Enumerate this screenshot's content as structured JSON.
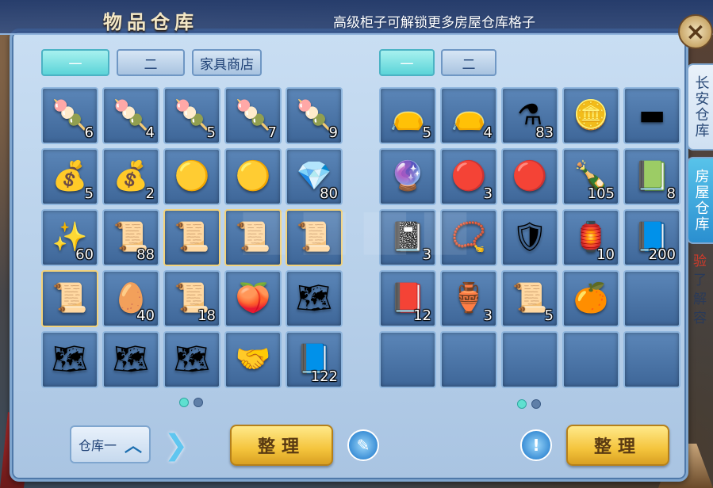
{
  "header": {
    "title": "物品仓库",
    "subtitle": "高级柜子可解锁更多房屋仓库格子",
    "close_icon": "×"
  },
  "side_tabs": [
    {
      "label": "长安仓库",
      "active": false
    },
    {
      "label": "房屋仓库",
      "active": true
    }
  ],
  "side_note": {
    "accent": "验",
    "text": "了解",
    "tail": "容"
  },
  "left_panel": {
    "tabs": [
      {
        "label": "一",
        "active": true
      },
      {
        "label": "二",
        "active": false
      },
      {
        "label": "家具商店",
        "active": false
      }
    ],
    "slots": [
      {
        "icon": "tangyuan-plate-brown",
        "glyph": "🍡",
        "count": "6"
      },
      {
        "icon": "tangyuan-plate-flower",
        "glyph": "🍡",
        "count": "4"
      },
      {
        "icon": "tangyuan-plate-red",
        "glyph": "🍡",
        "count": "5"
      },
      {
        "icon": "tangyuan-plate-pink",
        "glyph": "🍡",
        "count": "7"
      },
      {
        "icon": "tangyuan-plate-dark",
        "glyph": "🍡",
        "count": "9"
      },
      {
        "icon": "money-bag",
        "glyph": "💰",
        "count": "5"
      },
      {
        "icon": "money-bag",
        "glyph": "💰",
        "count": "2"
      },
      {
        "icon": "golden-orb",
        "glyph": "🟡",
        "count": ""
      },
      {
        "icon": "golden-orb",
        "glyph": "🟡",
        "count": ""
      },
      {
        "icon": "blue-crystal",
        "glyph": "💎",
        "count": "80"
      },
      {
        "icon": "sparkle-crystal",
        "glyph": "✨",
        "count": "60"
      },
      {
        "icon": "talisman-scroll",
        "glyph": "📜",
        "count": "88"
      },
      {
        "icon": "golden-scroll",
        "glyph": "📜",
        "count": "",
        "gold": true
      },
      {
        "icon": "golden-scroll",
        "glyph": "📜",
        "count": "",
        "gold": true
      },
      {
        "icon": "golden-scroll",
        "glyph": "📜",
        "count": "",
        "gold": true
      },
      {
        "icon": "golden-scroll",
        "glyph": "📜",
        "count": "",
        "gold": true
      },
      {
        "icon": "jade-egg",
        "glyph": "🥚",
        "count": "40"
      },
      {
        "icon": "fire-scroll",
        "glyph": "📜",
        "count": "18"
      },
      {
        "icon": "peach",
        "glyph": "🍑",
        "count": ""
      },
      {
        "icon": "treasure-map",
        "glyph": "🗺",
        "count": ""
      },
      {
        "icon": "treasure-map",
        "glyph": "🗺",
        "count": ""
      },
      {
        "icon": "treasure-map",
        "glyph": "🗺",
        "count": ""
      },
      {
        "icon": "treasure-map",
        "glyph": "🗺",
        "count": ""
      },
      {
        "icon": "handshake-badge",
        "glyph": "🤝",
        "count": ""
      },
      {
        "icon": "blue-book",
        "glyph": "📘",
        "count": "122"
      }
    ],
    "page_dots": [
      true,
      false
    ]
  },
  "right_panel": {
    "tabs": [
      {
        "label": "一",
        "active": true
      },
      {
        "label": "二",
        "active": false
      }
    ],
    "slots": [
      {
        "icon": "black-pouch",
        "glyph": "👝",
        "count": "5"
      },
      {
        "icon": "black-pouch",
        "glyph": "👝",
        "count": "4"
      },
      {
        "icon": "potion-flask",
        "glyph": "⚗",
        "count": "83"
      },
      {
        "icon": "silver-ingot",
        "glyph": "🪙",
        "count": ""
      },
      {
        "icon": "silver-bar",
        "glyph": "▬",
        "count": ""
      },
      {
        "icon": "crystal-ball",
        "glyph": "🔮",
        "count": ""
      },
      {
        "icon": "red-stone",
        "glyph": "🔴",
        "count": "3"
      },
      {
        "icon": "red-stone",
        "glyph": "🔴",
        "count": ""
      },
      {
        "icon": "green-bottle",
        "glyph": "🍾",
        "count": "105"
      },
      {
        "icon": "teal-book",
        "glyph": "📗",
        "count": "8"
      },
      {
        "icon": "black-book",
        "glyph": "📓",
        "count": "3"
      },
      {
        "icon": "necklace",
        "glyph": "📿",
        "count": ""
      },
      {
        "icon": "armor-wings",
        "glyph": "🛡",
        "count": ""
      },
      {
        "icon": "lantern",
        "glyph": "🏮",
        "count": "10"
      },
      {
        "icon": "blue-book",
        "glyph": "📘",
        "count": "200"
      },
      {
        "icon": "red-book",
        "glyph": "📕",
        "count": "12"
      },
      {
        "icon": "gourd-bag",
        "glyph": "🏺",
        "count": "3"
      },
      {
        "icon": "paper-scroll",
        "glyph": "📜",
        "count": "5"
      },
      {
        "icon": "oranges",
        "glyph": "🍊",
        "count": ""
      },
      {
        "icon": "empty",
        "glyph": "",
        "count": ""
      },
      {
        "icon": "empty",
        "glyph": "",
        "count": ""
      },
      {
        "icon": "empty",
        "glyph": "",
        "count": ""
      },
      {
        "icon": "empty",
        "glyph": "",
        "count": ""
      },
      {
        "icon": "empty",
        "glyph": "",
        "count": ""
      },
      {
        "icon": "empty",
        "glyph": "",
        "count": ""
      }
    ],
    "page_dots": [
      true,
      false
    ]
  },
  "bottom": {
    "warehouse_select_label": "仓库一",
    "chevron_up": "︿",
    "arrow": "❯",
    "sort_left_label": "整理",
    "sort_right_label": "整理",
    "edit_icon": "✎",
    "info_icon": "!"
  },
  "colors": {
    "panel": "#b6cfe9",
    "slot": "#4a76a8",
    "active_tab": "#5bd4d8",
    "gold_button": "#f4c43c"
  }
}
